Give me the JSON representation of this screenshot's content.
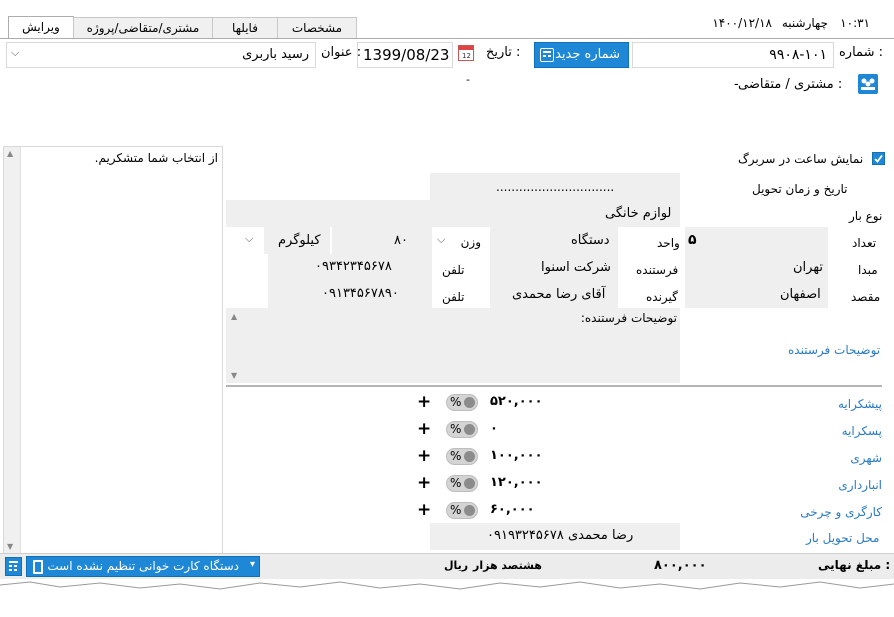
{
  "top": {
    "time": "۱۰:۳۱",
    "weekday": "چهارشنبه",
    "date": "۱۴۰۰/۱۲/۱۸"
  },
  "tabs": [
    "ویرایش",
    "مشتری/متقاضی/پروژه",
    "فایلها",
    "مشخصات"
  ],
  "header": {
    "number_label": "شماره :",
    "number_value": "۹۹۰۸-۱۰۱",
    "new_number_button": "شماره جدید",
    "date_label": "تاریخ :",
    "date_value": "1399/08/23",
    "title_label": "عنوان :",
    "title_value": "رسید باربری",
    "customer_label": "مشتری / متقاضی :",
    "customer_value": "-",
    "customer_value2": "-"
  },
  "notes": {
    "text": "از انتخاب شما متشکریم."
  },
  "form": {
    "show_time_label": "نمایش ساعت در سربرگ",
    "show_time_checked": true,
    "delivery_label": "تاریخ و زمان تحویل",
    "delivery_value": "...............................",
    "cargo_type_label": "نوع بار",
    "cargo_type_value": "لوازم خانگی",
    "count_label": "تعداد",
    "count_value": "۵",
    "unit_label": "واحد",
    "unit_value": "دستگاه",
    "weight_select": "وزن",
    "weight_value": "۸۰",
    "weight_unit": "کیلوگرم",
    "origin_label": "مبدا",
    "origin_value": "تهران",
    "sender_label": "فرستنده",
    "sender_value": "شرکت اسنوا",
    "sender_phone_label": "تلفن",
    "sender_phone": "۰۹۳۴۲۳۴۵۶۷۸",
    "dest_label": "مقصد",
    "dest_value": "اصفهان",
    "receiver_label": "گیرنده",
    "receiver_value": "آقای رضا محمدی",
    "receiver_phone_label": "تلفن",
    "receiver_phone": "۰۹۱۳۴۵۶۷۸۹۰",
    "sender_desc_label": "توضیحات فرستنده",
    "sender_desc_value": "توضیحات فرستنده:"
  },
  "costs": [
    {
      "label": "پیشکرایه",
      "value": "۵۲۰,۰۰۰"
    },
    {
      "label": "پسکرایه",
      "value": "۰"
    },
    {
      "label": "شهری",
      "value": "۱۰۰,۰۰۰"
    },
    {
      "label": "انبارداری",
      "value": "۱۲۰,۰۰۰"
    },
    {
      "label": "کارگری و چرخی",
      "value": "۶۰,۰۰۰"
    }
  ],
  "percent_symbol": "%",
  "plus_symbol": "+",
  "delivery_place": {
    "label": "محل تحویل بار",
    "value": "رضا محمدی ۰۹۱۹۳۲۴۵۶۷۸"
  },
  "footer": {
    "final_label": "مبلغ نهایی :",
    "final_value": "۸۰۰,۰۰۰",
    "words": "هشتصد هزار",
    "currency": "ریال",
    "card_reader": "دستگاه کارت خوانی تنظیم نشده است"
  },
  "colors": {
    "accent": "#1e88d6",
    "link": "#2a7ac4",
    "panel": "#efefef"
  }
}
